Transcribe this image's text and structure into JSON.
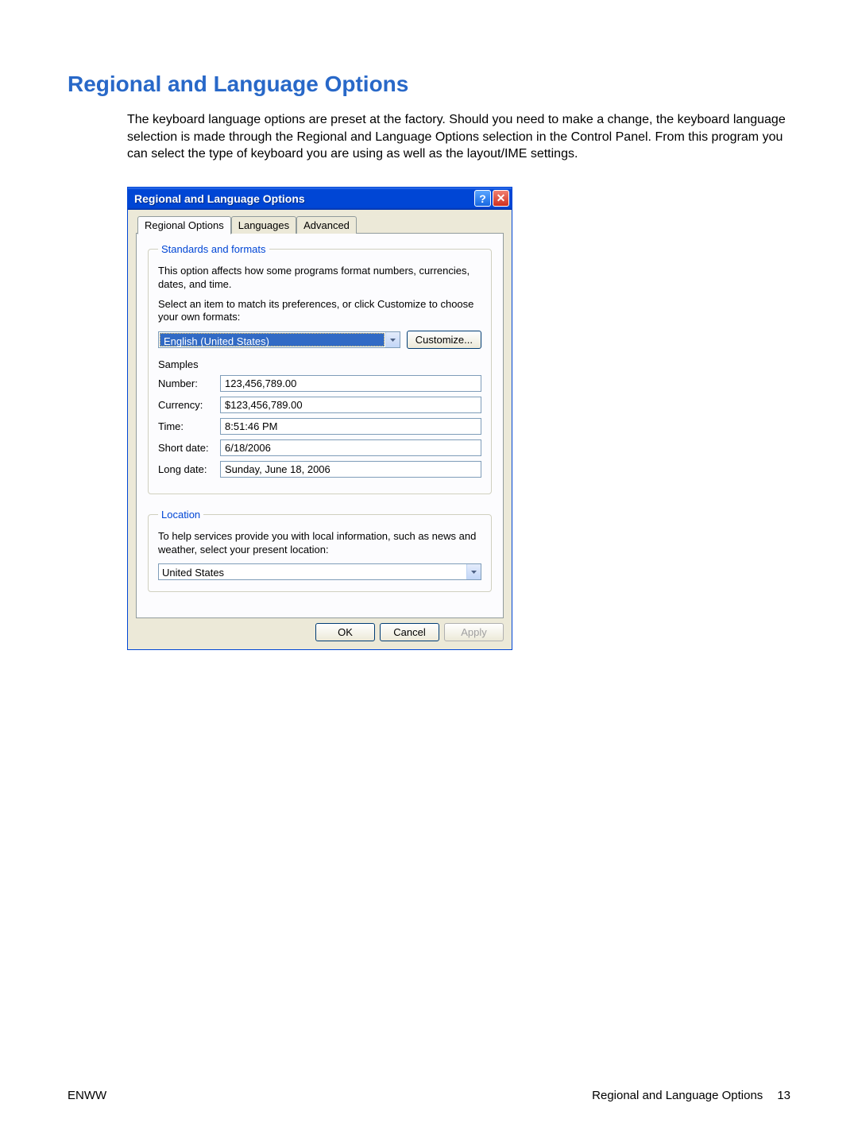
{
  "heading": "Regional and Language Options",
  "intro": "The keyboard language options are preset at the factory. Should you need to make a change, the keyboard language selection is made through the Regional and Language Options selection in the Control Panel. From this program you can select the type of keyboard you are using as well as the layout/IME settings.",
  "dialog": {
    "title": "Regional and Language Options",
    "tabs": [
      "Regional Options",
      "Languages",
      "Advanced"
    ],
    "standards": {
      "legend": "Standards and formats",
      "desc1": "This option affects how some programs format numbers, currencies, dates, and time.",
      "desc2": "Select an item to match its preferences, or click Customize to choose your own formats:",
      "selected": "English (United States)",
      "customize": "Customize...",
      "samplesLabel": "Samples",
      "samples": {
        "numberLabel": "Number:",
        "number": "123,456,789.00",
        "currencyLabel": "Currency:",
        "currency": "$123,456,789.00",
        "timeLabel": "Time:",
        "time": "8:51:46 PM",
        "shortDateLabel": "Short date:",
        "shortDate": "6/18/2006",
        "longDateLabel": "Long date:",
        "longDate": "Sunday, June 18, 2006"
      }
    },
    "location": {
      "legend": "Location",
      "desc": "To help services provide you with local information, such as news and weather, select your present location:",
      "selected": "United States"
    },
    "buttons": {
      "ok": "OK",
      "cancel": "Cancel",
      "apply": "Apply"
    }
  },
  "footer": {
    "left": "ENWW",
    "rightText": "Regional and Language Options",
    "pageNum": "13"
  }
}
